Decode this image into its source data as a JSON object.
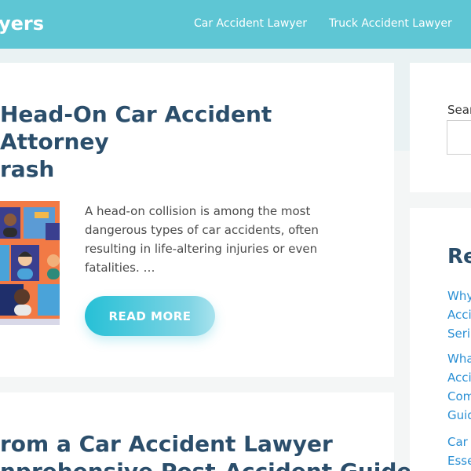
{
  "header": {
    "logo_text": "yers",
    "nav": [
      {
        "label": "Car Accident Lawyer"
      },
      {
        "label": "Truck Accident Lawyer"
      }
    ]
  },
  "post1": {
    "title_line1": "Head-On Car Accident Attorney",
    "title_line2": "rash",
    "excerpt": "A head-on collision is among the most dangerous types of car accidents, often resulting in life-altering injuries or even fatalities. …",
    "read_more": "READ MORE"
  },
  "post2": {
    "title_line1": "rom a Car Accident Lawyer",
    "title_line2": "nprehensive Post-Accident Guide"
  },
  "sidebar": {
    "search_label": "Sear",
    "search_placeholder": "",
    "recent_heading": "Re",
    "recent_links": [
      {
        "l1": "Why",
        "l2": "Acci",
        "l3": "Seri"
      },
      {
        "l1": "Wha",
        "l2": "Acci",
        "l3": "Com",
        "l4": "Guid"
      },
      {
        "l1": "Car",
        "l2": "Esse"
      }
    ]
  },
  "colors": {
    "header_bg": "#5ec6d4",
    "title_color": "#2b4e6b",
    "link_color": "#2a8fd4",
    "button_gradient_start": "#26c0d6",
    "thumb_bg": "#f27a45"
  }
}
